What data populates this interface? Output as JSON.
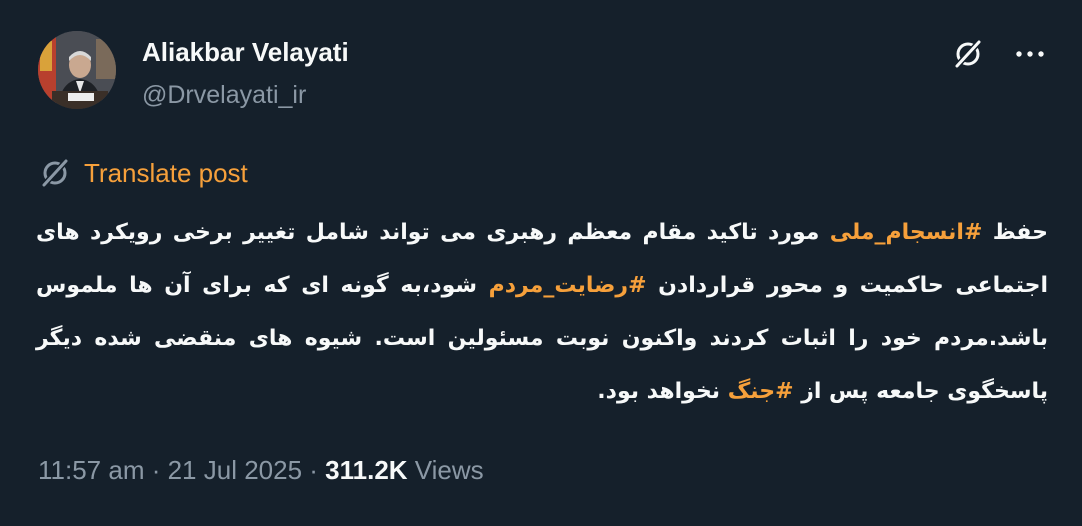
{
  "author": {
    "name": "Aliakbar Velayati",
    "handle": "@Drvelayati_ir"
  },
  "header": {
    "grok_icon": "grok-slash-icon",
    "more_icon": "ellipsis-icon"
  },
  "translate": {
    "icon": "grok-slash-icon",
    "label": "Translate post"
  },
  "post": {
    "segments": [
      {
        "text": "حفظ ",
        "type": "text"
      },
      {
        "text": "#انسجام_ملی",
        "type": "hashtag"
      },
      {
        "text": " مورد تاکید مقام معظم رهبری می تواند شامل تغییر برخی رویکرد های اجتماعی حاکمیت و محور قراردادن ",
        "type": "text"
      },
      {
        "text": "#رضایت_مردم",
        "type": "hashtag"
      },
      {
        "text": " شود،به گونه ای که برای آن ها ملموس باشد.مردم خود را اثبات کردند واکنون نوبت مسئولین است. شیوه های منقضی شده دیگر پاسخگوی جامعه پس از  ",
        "type": "text"
      },
      {
        "text": "#جنگ",
        "type": "hashtag"
      },
      {
        "text": " نخواهد بود.",
        "type": "text"
      }
    ]
  },
  "meta": {
    "time": "11:57 am",
    "separator1": " · ",
    "date": "21 Jul 2025",
    "separator2": " · ",
    "views_count": "311.2K",
    "views_label": " Views"
  },
  "colors": {
    "background": "#15202b",
    "accent": "#f6a03b",
    "text_primary": "#f7f9f9",
    "text_secondary": "#8b98a5"
  }
}
